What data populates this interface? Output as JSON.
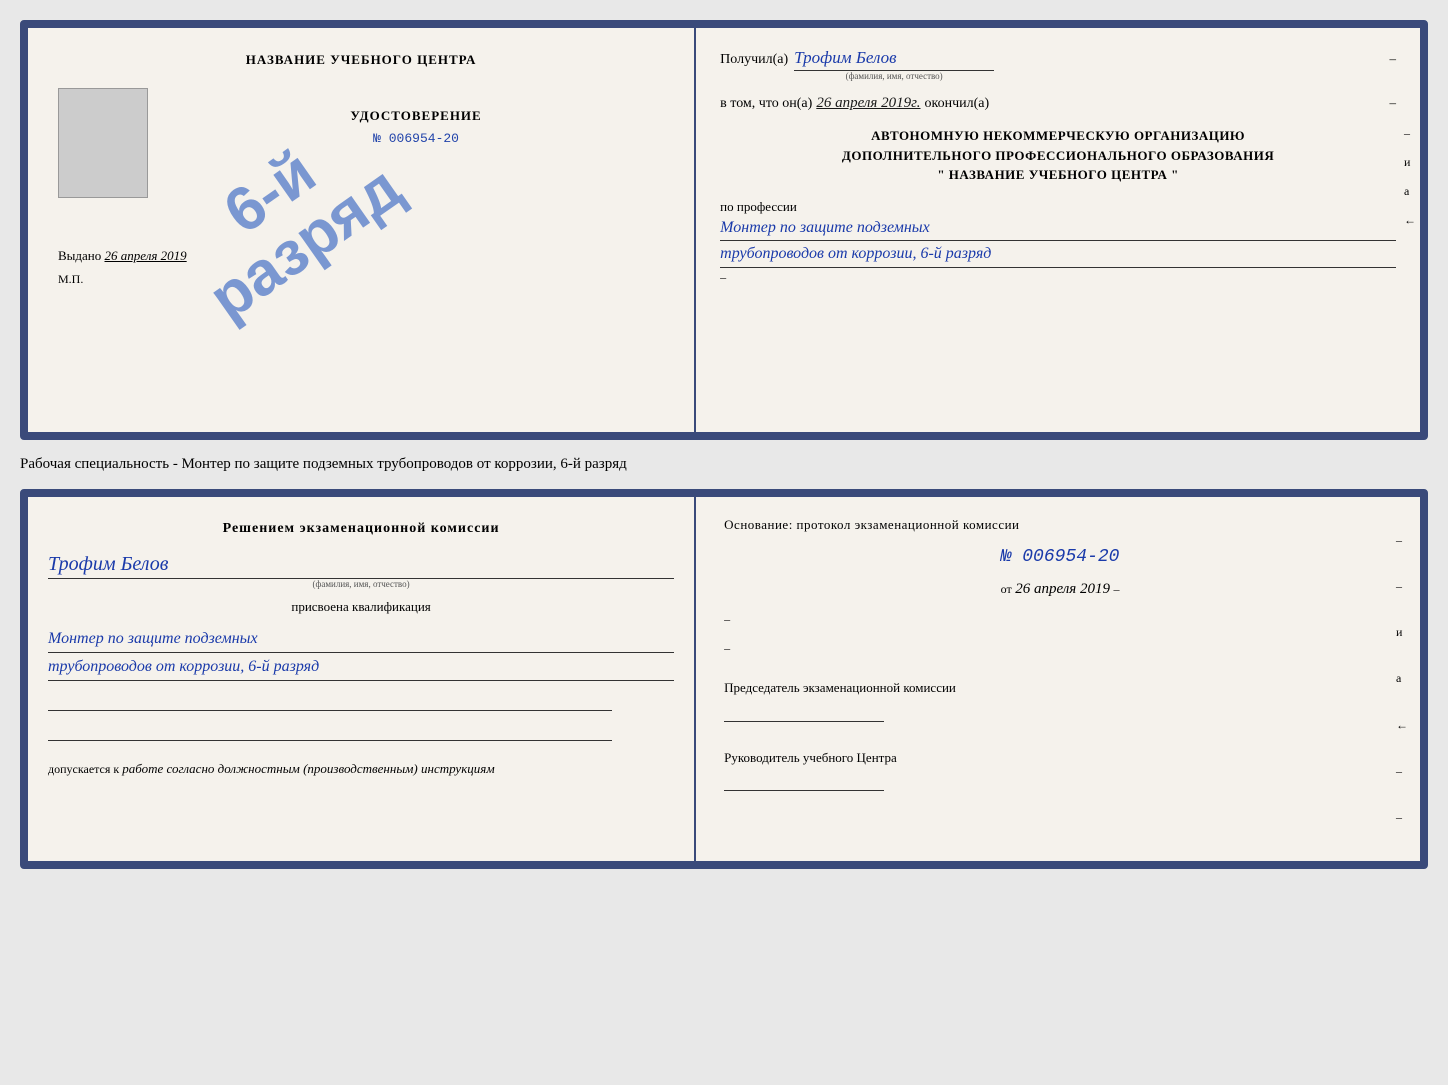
{
  "page": {
    "background": "#e8e8e8"
  },
  "top_cert": {
    "left": {
      "title": "НАЗВАНИЕ УЧЕБНОГО ЦЕНТРА",
      "photo_alt": "фото",
      "udost_label": "УДОСТОВЕРЕНИЕ",
      "udost_number": "№ 006954-20",
      "issued_label": "Выдано",
      "issued_date": "26 апреля 2019",
      "mp_label": "М.П."
    },
    "stamp": {
      "line1": "6-й",
      "line2": "разряд"
    },
    "right": {
      "received_label": "Получил(а)",
      "recipient_name": "Трофим Белов",
      "fio_sublabel": "(фамилия, имя, отчество)",
      "dash1": "–",
      "in_that_label": "в том, что он(а)",
      "completion_date": "26 апреля 2019г.",
      "finished_label": "окончил(а)",
      "dash2": "–",
      "org_line1": "АВТОНОМНУЮ НЕКОММЕРЧЕСКУЮ ОРГАНИЗАЦИЮ",
      "org_line2": "ДОПОЛНИТЕЛЬНОГО ПРОФЕССИОНАЛЬНОГО ОБРАЗОВАНИЯ",
      "org_name": "\" НАЗВАНИЕ УЧЕБНОГО ЦЕНТРА \"",
      "dash3": "–",
      "and_label": "и",
      "a_label": "а",
      "arrow_label": "←",
      "profession_label": "по профессии",
      "profession_line1": "Монтер по защите подземных",
      "profession_line2": "трубопроводов от коррозии, 6-й разряд",
      "dash4": "–"
    }
  },
  "between_label": "Рабочая специальность - Монтер по защите подземных трубопроводов от коррозии, 6-й разряд",
  "bottom_cert": {
    "left": {
      "decision_title": "Решением экзаменационной комиссии",
      "person_name": "Трофим Белов",
      "fio_sublabel": "(фамилия, имя, отчество)",
      "assigned_label": "присвоена квалификация",
      "qualification_line1": "Монтер по защите подземных",
      "qualification_line2": "трубопроводов от коррозии, 6-й разряд",
      "allowed_prefix": "допускается к",
      "allowed_text": "работе согласно должностным (производственным) инструкциям"
    },
    "right": {
      "basis_label": "Основание: протокол экзаменационной комиссии",
      "protocol_number": "№ 006954-20",
      "ot_prefix": "от",
      "protocol_date": "26 апреля 2019",
      "dash1": "–",
      "dash2": "–",
      "dash3": "–",
      "i_label": "и",
      "a_label": "а",
      "arrow_label": "←",
      "chairman_label": "Председатель экзаменационной комиссии",
      "head_label": "Руководитель учебного Центра",
      "dash4": "–",
      "dash5": "–",
      "dash6": "–",
      "dash7": "–"
    }
  }
}
